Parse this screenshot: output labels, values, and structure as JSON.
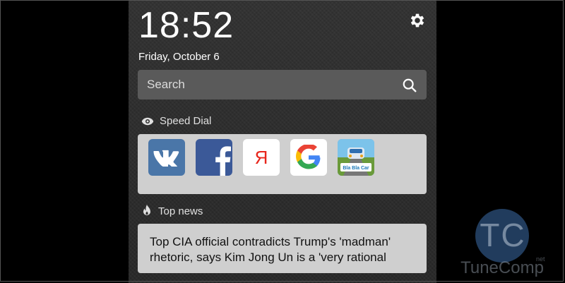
{
  "lockscreen": {
    "time": "18:52",
    "date": "Friday, October 6"
  },
  "search": {
    "placeholder": "Search"
  },
  "speed_dial": {
    "title": "Speed Dial",
    "items": [
      {
        "name": "VK",
        "icon": "vk-icon",
        "color": "#4a76a8"
      },
      {
        "name": "Facebook",
        "icon": "facebook-icon",
        "color": "#3b5998"
      },
      {
        "name": "Yandex",
        "icon": "yandex-icon",
        "color": "#ffffff"
      },
      {
        "name": "Google",
        "icon": "google-icon",
        "color": "#ffffff"
      },
      {
        "name": "BlaBlaCar",
        "icon": "blablacar-icon",
        "color": "#2b7fc3"
      }
    ]
  },
  "top_news": {
    "title": "Top news",
    "headline": "Top CIA official contradicts Trump's 'madman' rhetoric, says Kim Jong Un is a 'very rational"
  },
  "watermark": {
    "logo": "TC",
    "brand": "TuneComp",
    "suffix": "net"
  }
}
